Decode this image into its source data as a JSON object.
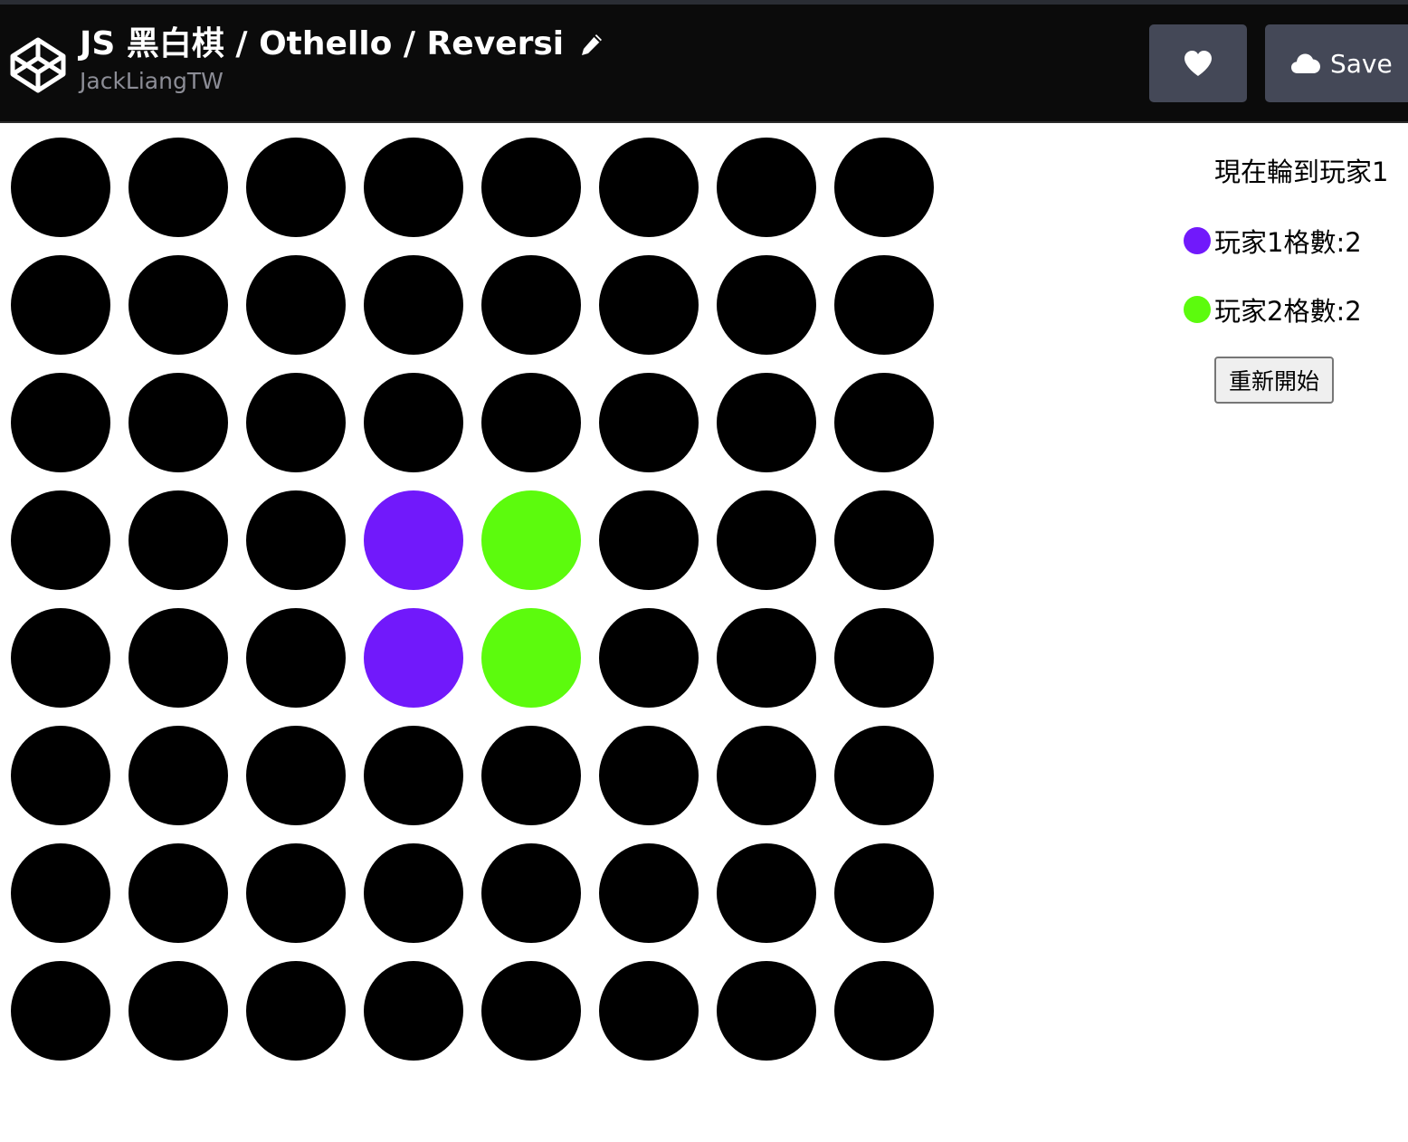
{
  "header": {
    "title": "JS 黑白棋 / Othello / Reversi",
    "author": "JackLiangTW",
    "logo_icon": "codepen-logo-icon",
    "edit_icon": "pencil-icon",
    "like_icon": "heart-icon",
    "save_icon": "cloud-icon",
    "save_label": "Save"
  },
  "colors": {
    "empty": "#000000",
    "player1": "#7119fb",
    "player2": "#5cfb0d",
    "header_bg": "#0b0b0b",
    "button_bg": "#444857"
  },
  "board": {
    "size": 8,
    "cells": [
      [
        0,
        0,
        0,
        0,
        0,
        0,
        0,
        0
      ],
      [
        0,
        0,
        0,
        0,
        0,
        0,
        0,
        0
      ],
      [
        0,
        0,
        0,
        0,
        0,
        0,
        0,
        0
      ],
      [
        0,
        0,
        0,
        1,
        2,
        0,
        0,
        0
      ],
      [
        0,
        0,
        0,
        1,
        2,
        0,
        0,
        0
      ],
      [
        0,
        0,
        0,
        0,
        0,
        0,
        0,
        0
      ],
      [
        0,
        0,
        0,
        0,
        0,
        0,
        0,
        0
      ],
      [
        0,
        0,
        0,
        0,
        0,
        0,
        0,
        0
      ]
    ]
  },
  "status": {
    "turn_text": "現在輪到玩家1",
    "player1_score_text": "玩家1格數:2",
    "player2_score_text": "玩家2格數:2",
    "restart_label": "重新開始"
  }
}
